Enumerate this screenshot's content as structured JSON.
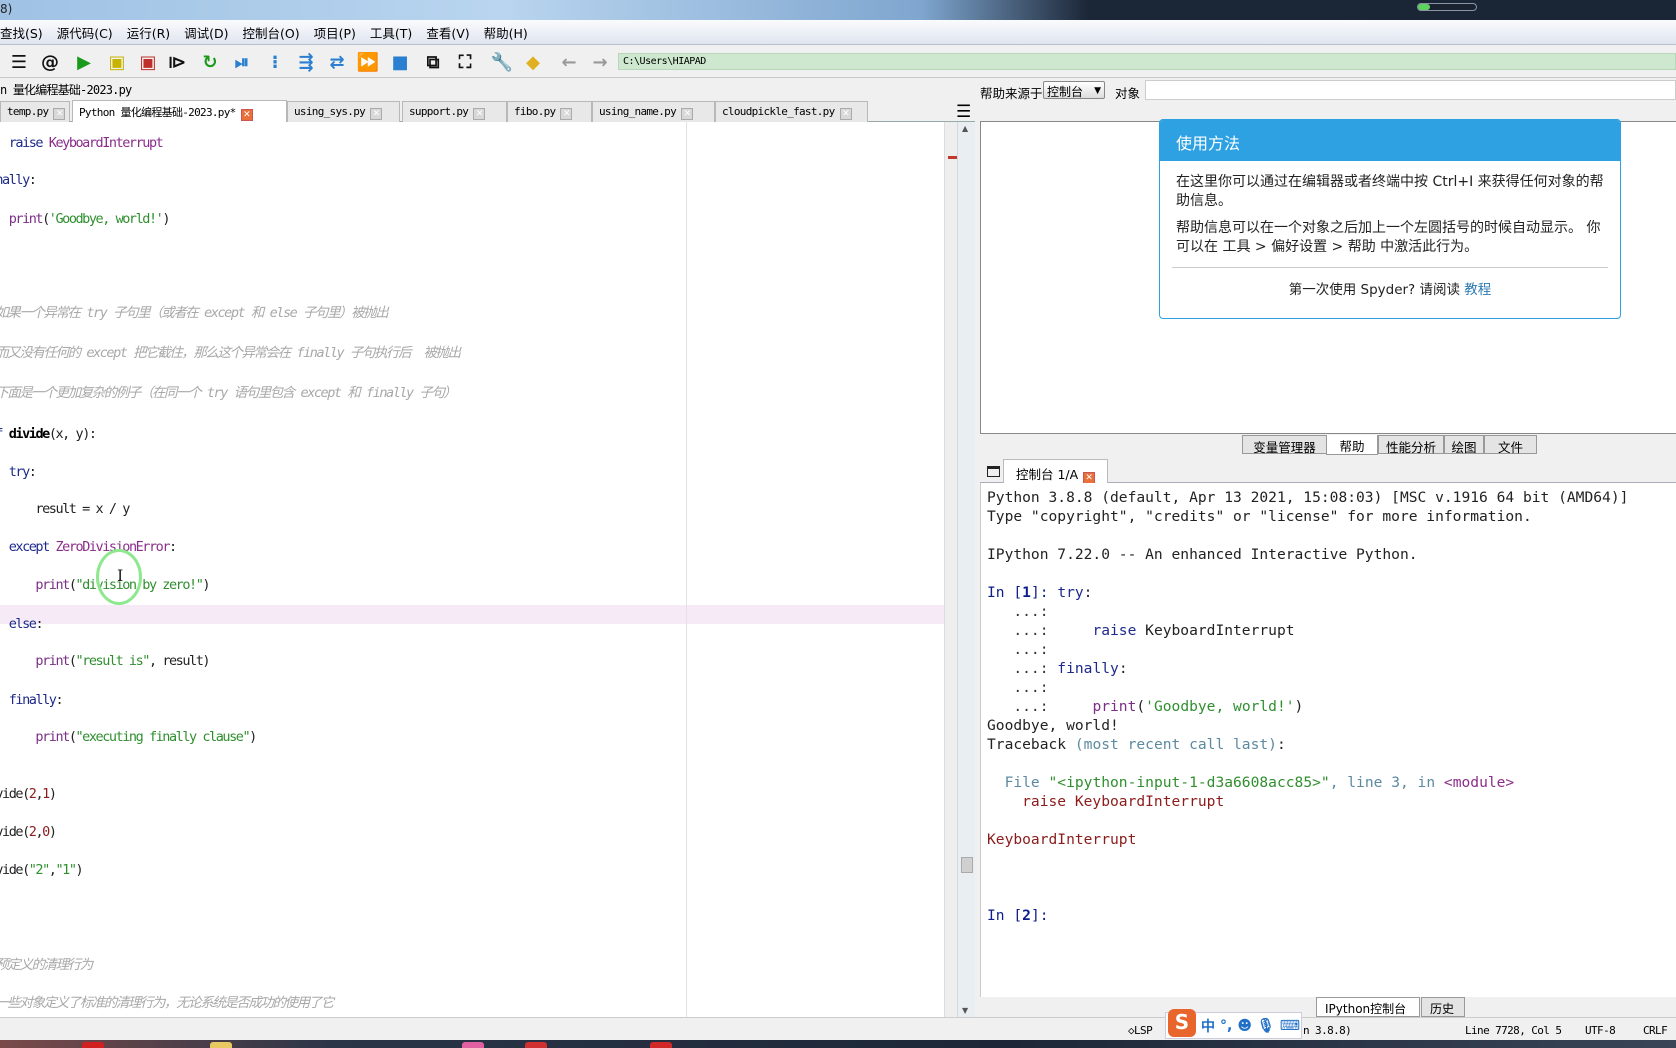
{
  "window": {
    "title_fragment": "8)",
    "path": "C:\\Users\\HIAPAD",
    "editor_title": "n 量化编程基础-2023.py"
  },
  "menu": [
    "查找(S)",
    "源代码(C)",
    "运行(R)",
    "调试(D)",
    "控制台(O)",
    "项目(P)",
    "工具(T)",
    "查看(V)",
    "帮助(H)"
  ],
  "toolbar": [
    {
      "icon": "list-icon",
      "glyph": "☰",
      "color": "#111111"
    },
    {
      "icon": "at-symbol-icon",
      "glyph": "@",
      "color": "#111111"
    },
    {
      "icon": "run-icon",
      "glyph": "▶",
      "color": "#1a9a1a"
    },
    {
      "icon": "run-cell-icon",
      "glyph": "▣",
      "color": "#c8b400"
    },
    {
      "icon": "run-cell-advance-icon",
      "glyph": "▣",
      "color": "#c0302a"
    },
    {
      "icon": "run-selection-icon",
      "glyph": "⧐",
      "color": "#111111"
    },
    {
      "icon": "rerun-icon",
      "glyph": "↻",
      "color": "#1a9a1a"
    },
    {
      "icon": "debug-icon",
      "glyph": "⏯",
      "color": "#2a7fd0"
    },
    {
      "icon": "step-icon",
      "glyph": "⁝",
      "color": "#2a7fd0"
    },
    {
      "icon": "step-into-icon",
      "glyph": "⇶",
      "color": "#2a7fd0"
    },
    {
      "icon": "step-return-icon",
      "glyph": "⇄",
      "color": "#2a7fd0"
    },
    {
      "icon": "continue-icon",
      "glyph": "⏩",
      "color": "#2a7fd0"
    },
    {
      "icon": "stop-icon",
      "glyph": "■",
      "color": "#2a7fd0"
    },
    {
      "icon": "maximize-pane-icon",
      "glyph": "⧉",
      "color": "#111111"
    },
    {
      "icon": "fullscreen-icon",
      "glyph": "⛶",
      "color": "#111111"
    },
    {
      "icon": "wrench-icon",
      "glyph": "🔧",
      "color": "#111111"
    },
    {
      "icon": "python-path-icon",
      "glyph": "◆",
      "color": "#e0b020"
    },
    {
      "icon": "back-arrow-icon",
      "glyph": "←",
      "color": "#999999"
    },
    {
      "icon": "forward-arrow-icon",
      "glyph": "→",
      "color": "#999999"
    }
  ],
  "editor": {
    "tabs": [
      {
        "label": "temp.py",
        "active": false
      },
      {
        "label": "Python 量化编程基础-2023.py*",
        "active": true
      },
      {
        "label": "using_sys.py",
        "active": false
      },
      {
        "label": "support.py",
        "active": false
      },
      {
        "label": "fibo.py",
        "active": false
      },
      {
        "label": "using_name.py",
        "active": false
      },
      {
        "label": "cloudpickle_fast.py",
        "active": false
      }
    ],
    "lines": [
      [
        [
          "    ",
          "pl"
        ],
        [
          "raise",
          "kw"
        ],
        [
          " ",
          "pl"
        ],
        [
          "KeyboardInterrupt",
          "cls"
        ]
      ],
      [
        [
          "finally",
          "kw"
        ],
        [
          ":",
          "pl"
        ]
      ],
      [
        [
          "    ",
          "pl"
        ],
        [
          "print",
          "bi"
        ],
        [
          "(",
          "pl"
        ],
        [
          "'Goodbye, world!'",
          "str"
        ],
        [
          ")",
          "pl"
        ]
      ],
      [
        [
          "# 如果一个异常在 try 子句里（或者在 except 和 else 子句里）被抛出",
          "cm"
        ]
      ],
      [
        [
          "# 而又没有任何的 except 把它截住，那么这个异常会在 finally 子句执行后  被抛出",
          "cm"
        ]
      ],
      [
        [
          "# 下面是一个更加复杂的例子（在同一个 try 语句里包含 except 和 finally 子句）",
          "cm"
        ]
      ],
      [
        [
          "def",
          "kw"
        ],
        [
          " ",
          "pl"
        ],
        [
          "divide",
          "fn"
        ],
        [
          "(x, y):",
          "pl"
        ]
      ],
      [
        [
          "    ",
          "pl"
        ],
        [
          "try",
          "kw"
        ],
        [
          ":",
          "pl"
        ]
      ],
      [
        [
          "        result = x / y",
          "pl"
        ]
      ],
      [
        [
          "    ",
          "pl"
        ],
        [
          "except",
          "kw"
        ],
        [
          " ",
          "pl"
        ],
        [
          "ZeroDivisionError",
          "cls"
        ],
        [
          ":",
          "pl"
        ]
      ],
      [
        [
          "        ",
          "pl"
        ],
        [
          "print",
          "bi"
        ],
        [
          "(",
          "pl"
        ],
        [
          "\"division by zero!\"",
          "str"
        ],
        [
          ")",
          "pl"
        ]
      ],
      [
        [
          "    ",
          "pl"
        ],
        [
          "else",
          "kw"
        ],
        [
          ":",
          "pl"
        ]
      ],
      [
        [
          "        ",
          "pl"
        ],
        [
          "print",
          "bi"
        ],
        [
          "(",
          "pl"
        ],
        [
          "\"result is\"",
          "str"
        ],
        [
          ", result)",
          "pl"
        ]
      ],
      [
        [
          "    ",
          "pl"
        ],
        [
          "finally",
          "kw"
        ],
        [
          ":",
          "pl"
        ]
      ],
      [
        [
          "        ",
          "pl"
        ],
        [
          "print",
          "bi"
        ],
        [
          "(",
          "pl"
        ],
        [
          "\"executing finally clause\"",
          "str"
        ],
        [
          ")",
          "pl"
        ]
      ],
      [
        [
          "divide(",
          "pl"
        ],
        [
          "2",
          "num"
        ],
        [
          ",",
          "pl"
        ],
        [
          "1",
          "num"
        ],
        [
          ")",
          "pl"
        ]
      ],
      [
        [
          "divide(",
          "pl"
        ],
        [
          "2",
          "num"
        ],
        [
          ",",
          "pl"
        ],
        [
          "0",
          "num"
        ],
        [
          ")",
          "pl"
        ]
      ],
      [
        [
          "divide(",
          "pl"
        ],
        [
          "\"2\"",
          "str"
        ],
        [
          ",",
          "pl"
        ],
        [
          "\"1\"",
          "str"
        ],
        [
          ")",
          "pl"
        ]
      ],
      [
        [
          "# 预定义的清理行为",
          "cm"
        ]
      ],
      [
        [
          "# 一些对象定义了标准的清理行为，无论系统是否成功的使用了它",
          "cm"
        ]
      ]
    ]
  },
  "help": {
    "source_label": "帮助来源于",
    "source_value": "控制台",
    "object_label": "对象",
    "card_title": "使用方法",
    "para1": "在这里你可以通过在编辑器或者终端中按 Ctrl+I 来获得任何对象的帮助信息。",
    "para2": "帮助信息可以在一个对象之后加上一个左圆括号的时候自动显示。 你可以在 工具 > 偏好设置 > 帮助 中激活此行为。",
    "footer": "第一次使用 Spyder? 请阅读 ",
    "footer_link": "教程"
  },
  "pane_tabs": [
    {
      "label": "变量管理器",
      "active": false
    },
    {
      "label": "帮助",
      "active": true
    },
    {
      "label": "性能分析",
      "active": false
    },
    {
      "label": "绘图",
      "active": false
    },
    {
      "label": "文件",
      "active": false
    }
  ],
  "console": {
    "tab_label": "控制台 1/A",
    "lines": [
      [
        [
          "Python 3.8.8 (default, Apr 13 2021, 15:08:03) [MSC v.1916 64 bit (AMD64)]",
          "pl"
        ]
      ],
      [
        [
          "Type \"copyright\", \"credits\" or \"license\" for more information.",
          "pl"
        ]
      ],
      [],
      [
        [
          "IPython 7.22.0 -- An enhanced Interactive Python.",
          "pl"
        ]
      ],
      [],
      [
        [
          "In [",
          "pr"
        ],
        [
          "1",
          "prn"
        ],
        [
          "]: ",
          "pr"
        ],
        [
          "try",
          "kw"
        ],
        [
          ":",
          "pl"
        ]
      ],
      [
        [
          "   ...:",
          "dots"
        ]
      ],
      [
        [
          "   ...:     ",
          "dots"
        ],
        [
          "raise",
          "kw"
        ],
        [
          " KeyboardInterrupt",
          "pl"
        ]
      ],
      [
        [
          "   ...:",
          "dots"
        ]
      ],
      [
        [
          "   ...: ",
          "dots"
        ],
        [
          "finally",
          "kw"
        ],
        [
          ":",
          "pl"
        ]
      ],
      [
        [
          "   ...:",
          "dots"
        ]
      ],
      [
        [
          "   ...:     ",
          "dots"
        ],
        [
          "print",
          "bi"
        ],
        [
          "(",
          "pl"
        ],
        [
          "'Goodbye, world!'",
          "str"
        ],
        [
          ")",
          "pl"
        ]
      ],
      [
        [
          "Goodbye, world!",
          "pl"
        ]
      ],
      [
        [
          "Traceback ",
          "pl"
        ],
        [
          "(most recent call last)",
          "tb-g"
        ],
        [
          ":",
          "pl"
        ]
      ],
      [],
      [
        [
          "  File ",
          "tb-g"
        ],
        [
          "\"<ipython-input-1-d3a6608acc85>\"",
          "str"
        ],
        [
          ", line 3, in ",
          "tb-g"
        ],
        [
          "<module>",
          "mod"
        ]
      ],
      [
        [
          "    raise KeyboardInterrupt",
          "err"
        ]
      ],
      [],
      [
        [
          "KeyboardInterrupt",
          "err"
        ]
      ],
      [],
      [],
      [],
      [
        [
          "In [",
          "pr"
        ],
        [
          "2",
          "prn"
        ],
        [
          "]: ",
          "pr"
        ]
      ]
    ],
    "bottom_tabs": [
      {
        "label": "IPython控制台",
        "active": true
      },
      {
        "label": "历史",
        "active": false
      }
    ]
  },
  "status": {
    "lsp": "LSP",
    "python_version": "n 3.8.8)",
    "position": "Line 7728, Col 5",
    "encoding": "UTF-8",
    "eol": "CRLF",
    "ime_mode": "中"
  },
  "colors": {
    "accent": "#2ea1e3",
    "path_bg": "#cde8cf",
    "current_line": "#f7eaf7"
  }
}
